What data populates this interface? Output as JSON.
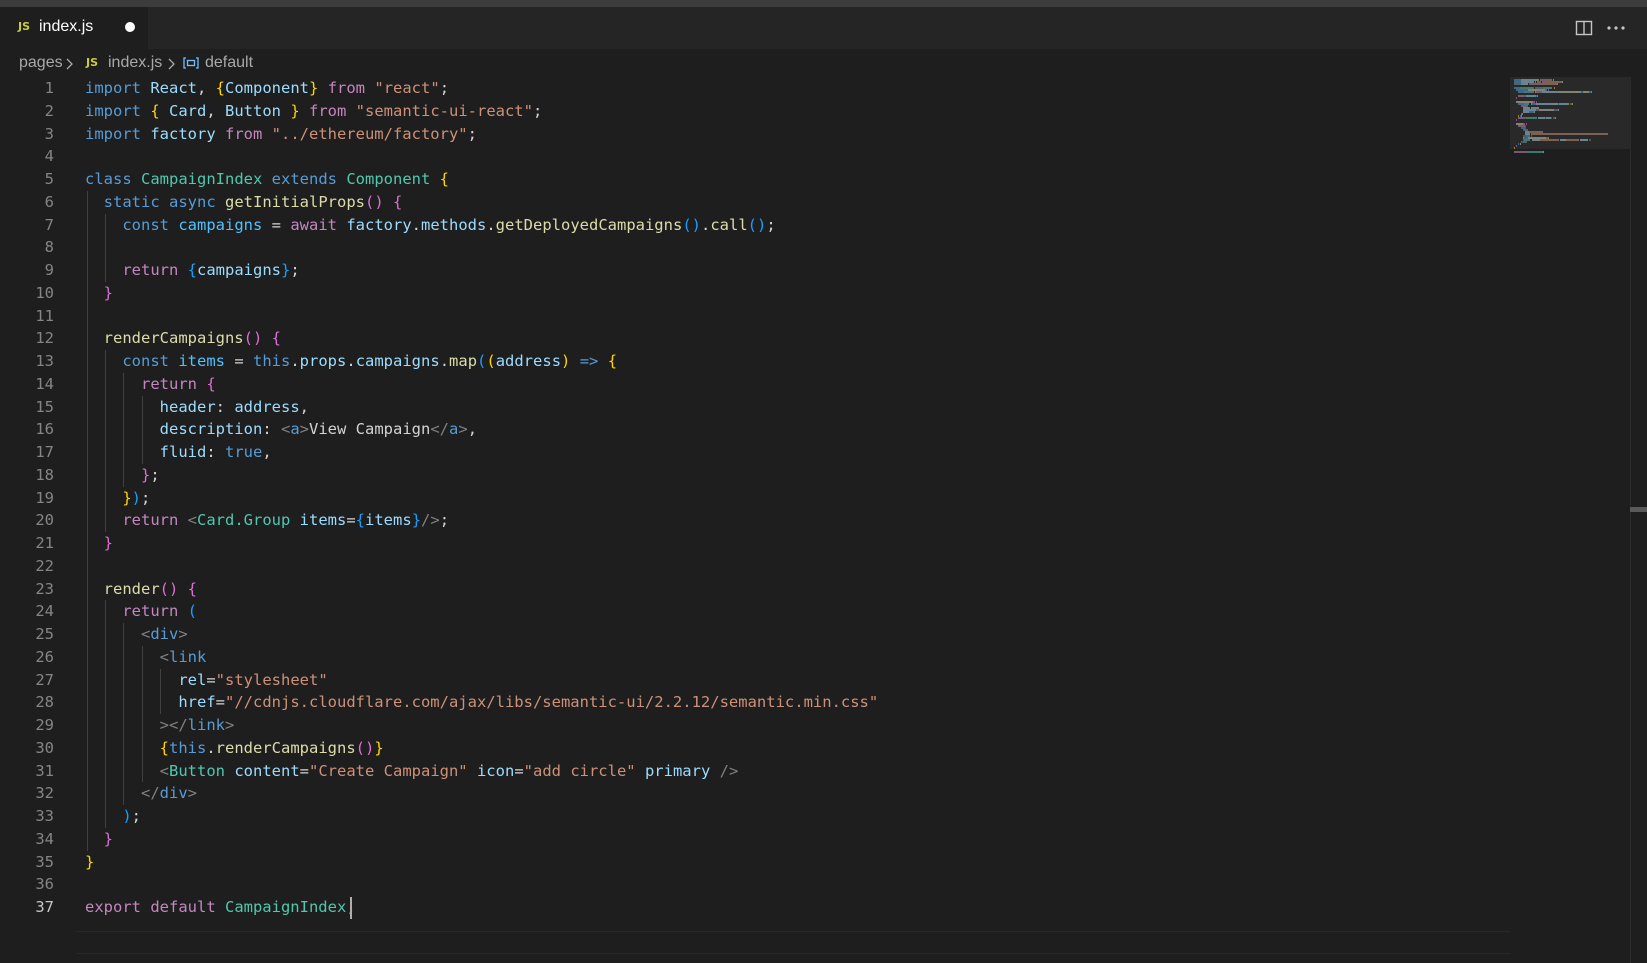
{
  "tab": {
    "icon": "JS",
    "label": "index.js",
    "modified": true
  },
  "toolbar": {
    "split_icon": "split-editor-icon",
    "more_icon": "more-actions-icon"
  },
  "breadcrumb": {
    "folder": "pages",
    "file_icon": "JS",
    "file": "index.js",
    "symbol_icon": "symbol-variable-icon",
    "symbol": "default"
  },
  "editor": {
    "active_line": 37,
    "lines": [
      [
        [
          "import ",
          "#569cd6"
        ],
        [
          "React",
          "#9cdcfe"
        ],
        [
          ", ",
          "#d4d4d4"
        ],
        [
          "{",
          "#ffd700"
        ],
        [
          "Component",
          "#9cdcfe"
        ],
        [
          "}",
          "#ffd700"
        ],
        [
          " from ",
          "#c586c0"
        ],
        [
          "\"react\"",
          "#ce9178"
        ],
        [
          ";",
          "#d4d4d4"
        ]
      ],
      [
        [
          "import ",
          "#569cd6"
        ],
        [
          "{ ",
          "#ffd700"
        ],
        [
          "Card",
          "#9cdcfe"
        ],
        [
          ", ",
          "#d4d4d4"
        ],
        [
          "Button",
          "#9cdcfe"
        ],
        [
          " }",
          "#ffd700"
        ],
        [
          " from ",
          "#c586c0"
        ],
        [
          "\"semantic-ui-react\"",
          "#ce9178"
        ],
        [
          ";",
          "#d4d4d4"
        ]
      ],
      [
        [
          "import ",
          "#569cd6"
        ],
        [
          "factory",
          "#9cdcfe"
        ],
        [
          " from ",
          "#c586c0"
        ],
        [
          "\"../ethereum/factory\"",
          "#ce9178"
        ],
        [
          ";",
          "#d4d4d4"
        ]
      ],
      [],
      [
        [
          "class ",
          "#569cd6"
        ],
        [
          "CampaignIndex",
          "#4ec9b0"
        ],
        [
          " extends ",
          "#569cd6"
        ],
        [
          "Component",
          "#4ec9b0"
        ],
        [
          " {",
          "#ffd700"
        ]
      ],
      [
        [
          "  static ",
          "#569cd6"
        ],
        [
          "async ",
          "#569cd6"
        ],
        [
          "getInitialProps",
          "#dcdcaa"
        ],
        [
          "()",
          "#da70d6"
        ],
        [
          " {",
          "#da70d6"
        ]
      ],
      [
        [
          "    const ",
          "#569cd6"
        ],
        [
          "campaigns",
          "#4fc1ff"
        ],
        [
          " = ",
          "#d4d4d4"
        ],
        [
          "await ",
          "#c586c0"
        ],
        [
          "factory",
          "#9cdcfe"
        ],
        [
          ".",
          "#d4d4d4"
        ],
        [
          "methods",
          "#9cdcfe"
        ],
        [
          ".",
          "#d4d4d4"
        ],
        [
          "getDeployedCampaigns",
          "#dcdcaa"
        ],
        [
          "()",
          "#179fff"
        ],
        [
          ".",
          "#d4d4d4"
        ],
        [
          "call",
          "#dcdcaa"
        ],
        [
          "()",
          "#179fff"
        ],
        [
          ";",
          "#d4d4d4"
        ]
      ],
      [],
      [
        [
          "    return ",
          "#c586c0"
        ],
        [
          "{",
          "#179fff"
        ],
        [
          "campaigns",
          "#9cdcfe"
        ],
        [
          "}",
          "#179fff"
        ],
        [
          ";",
          "#d4d4d4"
        ]
      ],
      [
        [
          "  }",
          "#da70d6"
        ]
      ],
      [],
      [
        [
          "  renderCampaigns",
          "#dcdcaa"
        ],
        [
          "()",
          "#da70d6"
        ],
        [
          " {",
          "#da70d6"
        ]
      ],
      [
        [
          "    const ",
          "#569cd6"
        ],
        [
          "items",
          "#4fc1ff"
        ],
        [
          " = ",
          "#d4d4d4"
        ],
        [
          "this",
          "#569cd6"
        ],
        [
          ".",
          "#d4d4d4"
        ],
        [
          "props",
          "#9cdcfe"
        ],
        [
          ".",
          "#d4d4d4"
        ],
        [
          "campaigns",
          "#9cdcfe"
        ],
        [
          ".",
          "#d4d4d4"
        ],
        [
          "map",
          "#dcdcaa"
        ],
        [
          "(",
          "#179fff"
        ],
        [
          "(",
          "#ffd700"
        ],
        [
          "address",
          "#9cdcfe"
        ],
        [
          ")",
          "#ffd700"
        ],
        [
          " => ",
          "#569cd6"
        ],
        [
          "{",
          "#ffd700"
        ]
      ],
      [
        [
          "      return ",
          "#c586c0"
        ],
        [
          "{",
          "#da70d6"
        ]
      ],
      [
        [
          "        header",
          "#9cdcfe"
        ],
        [
          ": ",
          "#d4d4d4"
        ],
        [
          "address",
          "#9cdcfe"
        ],
        [
          ",",
          "#d4d4d4"
        ]
      ],
      [
        [
          "        description",
          "#9cdcfe"
        ],
        [
          ": ",
          "#d4d4d4"
        ],
        [
          "<",
          "#808080"
        ],
        [
          "a",
          "#569cd6"
        ],
        [
          ">",
          "#808080"
        ],
        [
          "View Campaign",
          "#d4d4d4"
        ],
        [
          "</",
          "#808080"
        ],
        [
          "a",
          "#569cd6"
        ],
        [
          ">",
          "#808080"
        ],
        [
          ",",
          "#d4d4d4"
        ]
      ],
      [
        [
          "        fluid",
          "#9cdcfe"
        ],
        [
          ": ",
          "#d4d4d4"
        ],
        [
          "true",
          "#569cd6"
        ],
        [
          ",",
          "#d4d4d4"
        ]
      ],
      [
        [
          "      }",
          "#da70d6"
        ],
        [
          ";",
          "#d4d4d4"
        ]
      ],
      [
        [
          "    }",
          "#ffd700"
        ],
        [
          ")",
          "#179fff"
        ],
        [
          ";",
          "#d4d4d4"
        ]
      ],
      [
        [
          "    return ",
          "#c586c0"
        ],
        [
          "<",
          "#808080"
        ],
        [
          "Card.Group",
          "#4ec9b0"
        ],
        [
          " items",
          "#9cdcfe"
        ],
        [
          "=",
          "#d4d4d4"
        ],
        [
          "{",
          "#179fff"
        ],
        [
          "items",
          "#9cdcfe"
        ],
        [
          "}",
          "#179fff"
        ],
        [
          "/>",
          "#808080"
        ],
        [
          ";",
          "#d4d4d4"
        ]
      ],
      [
        [
          "  }",
          "#da70d6"
        ]
      ],
      [],
      [
        [
          "  render",
          "#dcdcaa"
        ],
        [
          "()",
          "#da70d6"
        ],
        [
          " {",
          "#da70d6"
        ]
      ],
      [
        [
          "    return ",
          "#c586c0"
        ],
        [
          "(",
          "#179fff"
        ]
      ],
      [
        [
          "      <",
          "#808080"
        ],
        [
          "div",
          "#569cd6"
        ],
        [
          ">",
          "#808080"
        ]
      ],
      [
        [
          "        <",
          "#808080"
        ],
        [
          "link",
          "#569cd6"
        ]
      ],
      [
        [
          "          rel",
          "#9cdcfe"
        ],
        [
          "=",
          "#d4d4d4"
        ],
        [
          "\"stylesheet\"",
          "#ce9178"
        ]
      ],
      [
        [
          "          href",
          "#9cdcfe"
        ],
        [
          "=",
          "#d4d4d4"
        ],
        [
          "\"//cdnjs.cloudflare.com/ajax/libs/semantic-ui/2.2.12/semantic.min.css\"",
          "#ce9178"
        ]
      ],
      [
        [
          "        ></",
          "#808080"
        ],
        [
          "link",
          "#569cd6"
        ],
        [
          ">",
          "#808080"
        ]
      ],
      [
        [
          "        {",
          "#ffd700"
        ],
        [
          "this",
          "#569cd6"
        ],
        [
          ".",
          "#d4d4d4"
        ],
        [
          "renderCampaigns",
          "#dcdcaa"
        ],
        [
          "()",
          "#da70d6"
        ],
        [
          "}",
          "#ffd700"
        ]
      ],
      [
        [
          "        <",
          "#808080"
        ],
        [
          "Button",
          "#4ec9b0"
        ],
        [
          " content",
          "#9cdcfe"
        ],
        [
          "=",
          "#d4d4d4"
        ],
        [
          "\"Create Campaign\"",
          "#ce9178"
        ],
        [
          " icon",
          "#9cdcfe"
        ],
        [
          "=",
          "#d4d4d4"
        ],
        [
          "\"add circle\"",
          "#ce9178"
        ],
        [
          " primary",
          "#9cdcfe"
        ],
        [
          " />",
          "#808080"
        ]
      ],
      [
        [
          "      </",
          "#808080"
        ],
        [
          "div",
          "#569cd6"
        ],
        [
          ">",
          "#808080"
        ]
      ],
      [
        [
          "    )",
          "#179fff"
        ],
        [
          ";",
          "#d4d4d4"
        ]
      ],
      [
        [
          "  }",
          "#da70d6"
        ]
      ],
      [
        [
          "}",
          "#ffd700"
        ]
      ],
      [],
      [
        [
          "export ",
          "#c586c0"
        ],
        [
          "default ",
          "#c586c0"
        ],
        [
          "CampaignIndex",
          "#4ec9b0"
        ],
        [
          ";",
          "#d4d4d4"
        ]
      ]
    ]
  }
}
